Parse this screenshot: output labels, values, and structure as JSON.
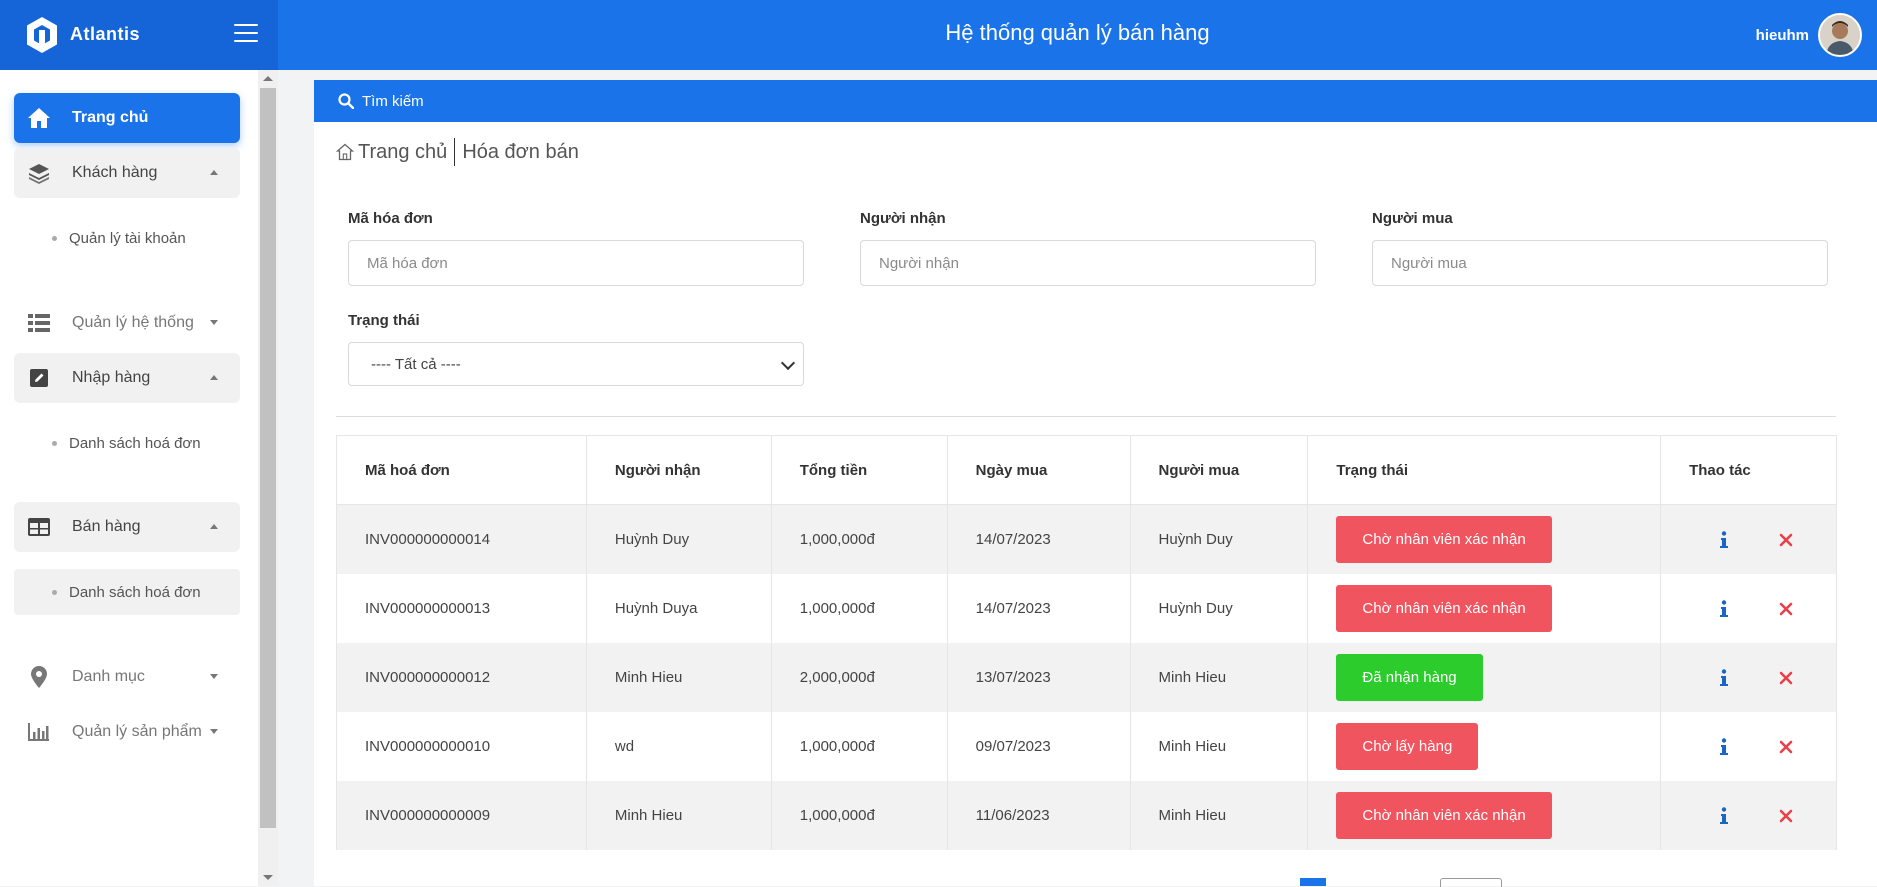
{
  "brand": {
    "name": "Atlantis"
  },
  "header": {
    "title": "Hệ thống quản lý bán hàng",
    "username": "hieuhm"
  },
  "sidebar": {
    "items": [
      {
        "label": "Trang chủ"
      },
      {
        "label": "Khách hàng",
        "sub": "Quản lý tài khoản"
      },
      {
        "label": "Quản lý hệ thống"
      },
      {
        "label": "Nhập hàng",
        "sub": "Danh sách hoá đơn"
      },
      {
        "label": "Bán hàng",
        "sub": "Danh sách hoá đơn"
      },
      {
        "label": "Danh mục"
      },
      {
        "label": "Quản lý sản phẩm"
      }
    ]
  },
  "search": {
    "label": "Tìm kiếm"
  },
  "breadcrumb": {
    "home": "Trang chủ",
    "current": "Hóa đơn bán"
  },
  "filters": {
    "invoice_label": "Mã hóa đơn",
    "invoice_placeholder": "Mã hóa đơn",
    "receiver_label": "Người nhận",
    "receiver_placeholder": "Người nhận",
    "buyer_label": "Người mua",
    "buyer_placeholder": "Người mua",
    "status_label": "Trạng thái",
    "status_value": "---- Tất cả ----"
  },
  "table": {
    "headers": [
      "Mã hoá đơn",
      "Người nhận",
      "Tổng tiền",
      "Ngày mua",
      "Người mua",
      "Trạng thái",
      "Thao tác"
    ],
    "rows": [
      {
        "id": "INV000000000014",
        "receiver": "Huỳnh Duy",
        "total": "1,000,000đ",
        "date": "14/07/2023",
        "buyer": "Huỳnh Duy",
        "status": "Chờ nhân viên xác nhận"
      },
      {
        "id": "INV000000000013",
        "receiver": "Huỳnh Duya",
        "total": "1,000,000đ",
        "date": "14/07/2023",
        "buyer": "Huỳnh Duy",
        "status": "Chờ nhân viên xác nhận"
      },
      {
        "id": "INV000000000012",
        "receiver": "Minh Hieu",
        "total": "2,000,000đ",
        "date": "13/07/2023",
        "buyer": "Minh Hieu",
        "status": "Đã nhận hàng"
      },
      {
        "id": "INV000000000010",
        "receiver": "wd",
        "total": "1,000,000đ",
        "date": "09/07/2023",
        "buyer": "Minh Hieu",
        "status": "Chờ lấy hàng"
      },
      {
        "id": "INV000000000009",
        "receiver": "Minh Hieu",
        "total": "1,000,000đ",
        "date": "11/06/2023",
        "buyer": "Minh Hieu",
        "status": "Chờ nhân viên xác nhận"
      }
    ]
  },
  "colors": {
    "primary": "#1a73e8",
    "danger": "#f0545e",
    "success": "#2dcc2d"
  },
  "icons": {
    "info": "info-icon",
    "delete": "delete-icon"
  }
}
